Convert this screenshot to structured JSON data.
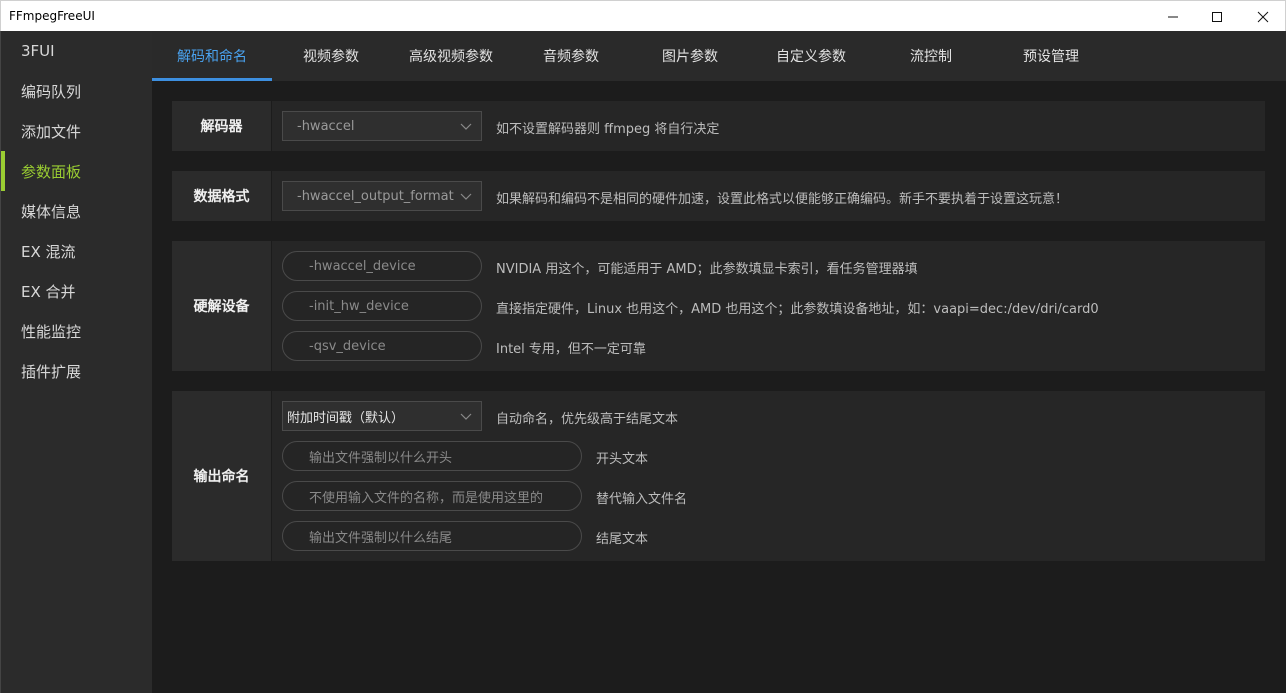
{
  "window": {
    "title": "FFmpegFreeUI"
  },
  "sidebar": {
    "items": [
      {
        "label": "3FUI"
      },
      {
        "label": "编码队列"
      },
      {
        "label": "添加文件"
      },
      {
        "label": "参数面板"
      },
      {
        "label": "媒体信息"
      },
      {
        "label": "EX 混流"
      },
      {
        "label": "EX 合并"
      },
      {
        "label": "性能监控"
      },
      {
        "label": "插件扩展"
      }
    ],
    "active_index": 3,
    "accent": "#9acd32"
  },
  "tabs": [
    {
      "label": "解码和命名"
    },
    {
      "label": "视频参数"
    },
    {
      "label": "高级视频参数"
    },
    {
      "label": "音频参数"
    },
    {
      "label": "图片参数"
    },
    {
      "label": "自定义参数"
    },
    {
      "label": "流控制"
    },
    {
      "label": "预设管理"
    }
  ],
  "tab_accent": "#3d8fe0",
  "decoder": {
    "label": "解码器",
    "select_placeholder": "-hwaccel",
    "hint": "如不设置解码器则 ffmpeg 将自行决定"
  },
  "data_format": {
    "label": "数据格式",
    "select_placeholder": "-hwaccel_output_format",
    "hint": "如果解码和编码不是相同的硬件加速，设置此格式以便能够正确编码。新手不要执着于设置这玩意！"
  },
  "hw_device": {
    "label": "硬解设备",
    "fields": [
      {
        "placeholder": "-hwaccel_device",
        "hint": "NVIDIA 用这个，可能适用于 AMD；此参数填显卡索引，看任务管理器填"
      },
      {
        "placeholder": "-init_hw_device",
        "hint": "直接指定硬件，Linux 也用这个，AMD 也用这个；此参数填设备地址，如：vaapi=dec:/dev/dri/card0"
      },
      {
        "placeholder": "-qsv_device",
        "hint": "Intel 专用，但不一定可靠"
      }
    ]
  },
  "output_naming": {
    "label": "输出命名",
    "select_value": "附加时间戳（默认）",
    "select_hint": "自动命名，优先级高于结尾文本",
    "fields": [
      {
        "placeholder": "输出文件强制以什么开头",
        "hint": "开头文本"
      },
      {
        "placeholder": "不使用输入文件的名称，而是使用这里的",
        "hint": "替代输入文件名"
      },
      {
        "placeholder": "输出文件强制以什么结尾",
        "hint": "结尾文本"
      }
    ]
  },
  "icons": {
    "minimize": "minimize-icon",
    "maximize": "maximize-icon",
    "close": "close-icon",
    "dropdown": "chevron-down-icon"
  }
}
